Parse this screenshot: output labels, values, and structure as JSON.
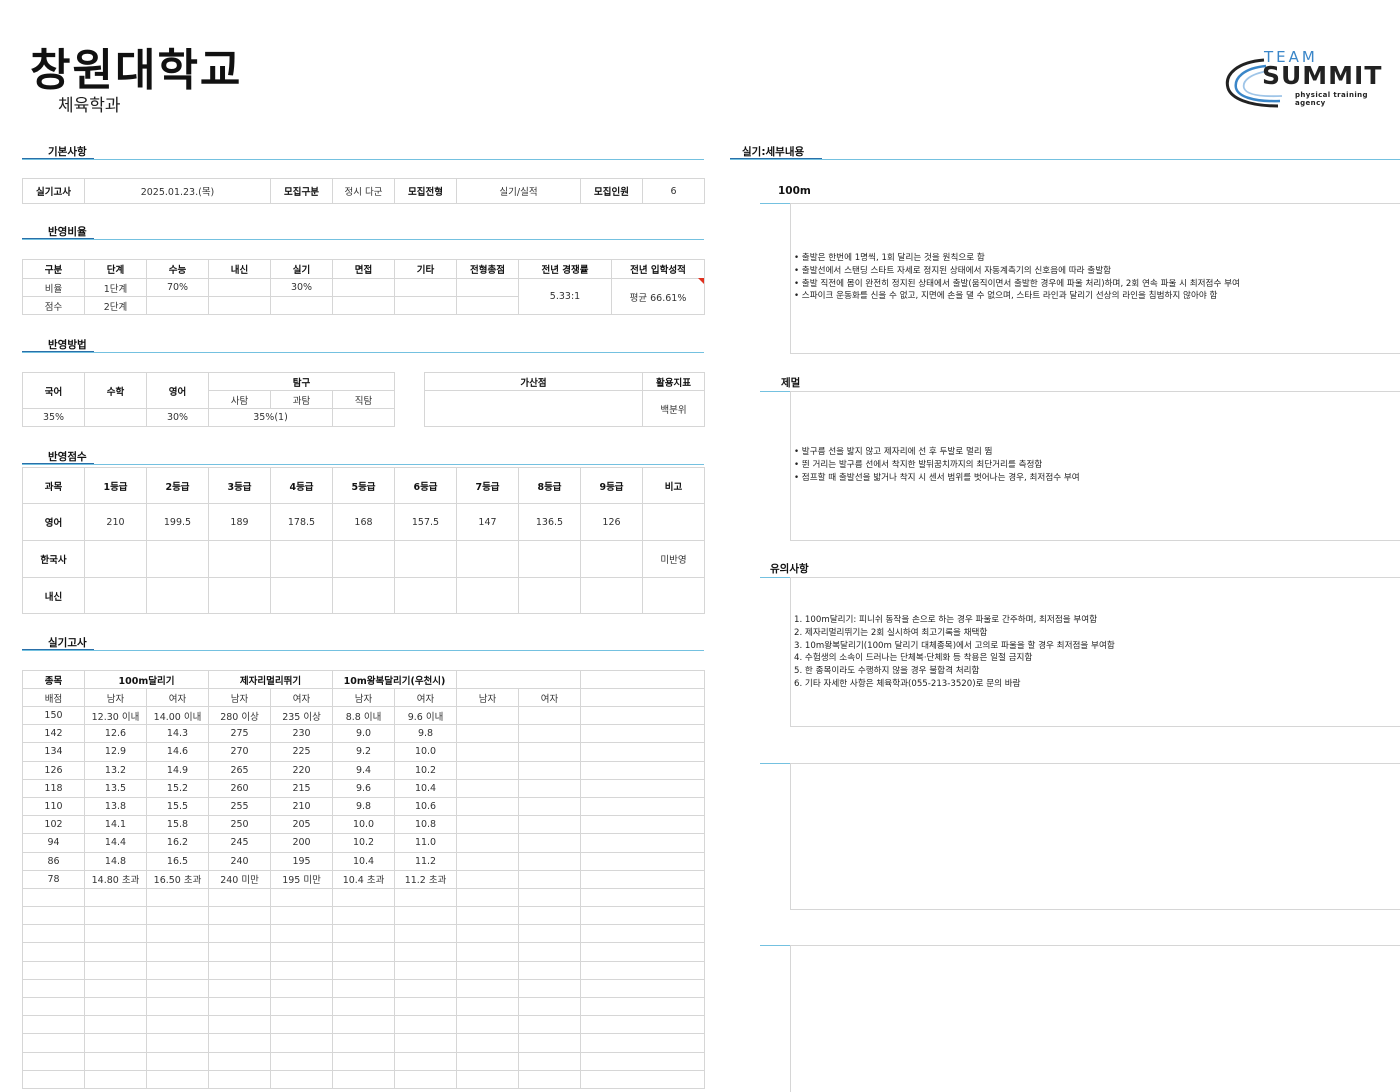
{
  "header": {
    "university": "창원대학교",
    "department": "체육학과"
  },
  "logo": {
    "team": "TEAM",
    "summit": "SUMMIT",
    "subtitle": "physical training agency",
    "accent": "#3a86c8"
  },
  "sections": {
    "basic": "기본사항",
    "ratio": "반영비율",
    "method": "반영방법",
    "score": "반영점수",
    "practical": "실기고사",
    "detail": "실기:세부내용"
  },
  "basic": {
    "exam_date_label": "실기고사",
    "exam_date": "2025.01.23.(목)",
    "recruit_type_label": "모집구분",
    "recruit_type": "정시 다군",
    "selection_label": "모집전형",
    "selection": "실기/실적",
    "quota_label": "모집인원",
    "quota": "6"
  },
  "ratio": {
    "headers": [
      "구분",
      "단계",
      "수능",
      "내신",
      "실기",
      "면접",
      "기타",
      "전형총점",
      "전년 경쟁률",
      "전년 입학성적"
    ],
    "row1": [
      "비율",
      "1단계",
      "70%",
      "",
      "30%",
      "",
      "",
      ""
    ],
    "row2": [
      "점수",
      "2단계",
      "",
      "",
      "",
      "",
      "",
      ""
    ],
    "competition": "5.33:1",
    "admission": "평균 66.61%"
  },
  "method": {
    "korean": "국어",
    "math": "수학",
    "english": "영어",
    "inquiry": "탐구",
    "social": "사탐",
    "science": "과탐",
    "vocational": "직탐",
    "bonus": "가산점",
    "indicator": "활용지표",
    "indicator_value": "백분위",
    "values": [
      "35%",
      "",
      "30%",
      "35%(1)",
      ""
    ]
  },
  "score": {
    "headers": [
      "과목",
      "1등급",
      "2등급",
      "3등급",
      "4등급",
      "5등급",
      "6등급",
      "7등급",
      "8등급",
      "9등급",
      "비고"
    ],
    "rows": [
      [
        "영어",
        "210",
        "199.5",
        "189",
        "178.5",
        "168",
        "157.5",
        "147",
        "136.5",
        "126",
        ""
      ],
      [
        "한국사",
        "",
        "",
        "",
        "",
        "",
        "",
        "",
        "",
        "",
        "미반영"
      ],
      [
        "내신",
        "",
        "",
        "",
        "",
        "",
        "",
        "",
        "",
        "",
        ""
      ]
    ]
  },
  "practical": {
    "item_label": "종목",
    "events": [
      "100m달리기",
      "제자리멀리뛰기",
      "10m왕복달리기(우천시)",
      ""
    ],
    "sub": [
      "배점",
      "남자",
      "여자",
      "남자",
      "여자",
      "남자",
      "여자",
      "남자",
      "여자",
      ""
    ],
    "rows": [
      [
        "150",
        "12.30 이내",
        "14.00 이내",
        "280 이상",
        "235 이상",
        "8.8 이내",
        "9.6 이내",
        "",
        "",
        ""
      ],
      [
        "142",
        "12.6",
        "14.3",
        "275",
        "230",
        "9.0",
        "9.8",
        "",
        "",
        ""
      ],
      [
        "134",
        "12.9",
        "14.6",
        "270",
        "225",
        "9.2",
        "10.0",
        "",
        "",
        ""
      ],
      [
        "126",
        "13.2",
        "14.9",
        "265",
        "220",
        "9.4",
        "10.2",
        "",
        "",
        ""
      ],
      [
        "118",
        "13.5",
        "15.2",
        "260",
        "215",
        "9.6",
        "10.4",
        "",
        "",
        ""
      ],
      [
        "110",
        "13.8",
        "15.5",
        "255",
        "210",
        "9.8",
        "10.6",
        "",
        "",
        ""
      ],
      [
        "102",
        "14.1",
        "15.8",
        "250",
        "205",
        "10.0",
        "10.8",
        "",
        "",
        ""
      ],
      [
        "94",
        "14.4",
        "16.2",
        "245",
        "200",
        "10.2",
        "11.0",
        "",
        "",
        ""
      ],
      [
        "86",
        "14.8",
        "16.5",
        "240",
        "195",
        "10.4",
        "11.2",
        "",
        "",
        ""
      ],
      [
        "78",
        "14.80 초과",
        "16.50 초과",
        "240 미만",
        "195 미만",
        "10.4 초과",
        "11.2 초과",
        "",
        "",
        ""
      ]
    ]
  },
  "detail": {
    "run_title": "100m",
    "run_items": [
      "• 출발은 한번에 1명씩, 1회 달리는 것을 원칙으로 함",
      "• 출발선에서 스탠딩 스타트 자세로 정지된 상태에서 자동계측기의 신호음에 따라 출발함",
      "• 출발 직전에 몸이 완전히 정지된 상태에서 출발(움직이면서 출발한 경우에 파울 처리)하며, 2회 연속 파울 시 최저점수 부여",
      "• 스파이크 운동화를 신을 수 없고, 지면에 손을 댈 수 없으며, 스타트 라인과 달리기 선상의 라인을 침범하지 않아야 함"
    ],
    "jump_title": "제멀",
    "jump_items": [
      "• 발구름 선을 밟지 않고 제자리에 선 후 두발로 멀리 뜀",
      "• 뛴 거리는 발구름 선에서 착지한 발뒤꿈치까지의 최단거리를 측정함",
      "• 점프할 때 출발선을 밟거나 착지 시 센서 범위를 벗어나는 경우, 최저점수 부여"
    ],
    "notice_title": "유의사항",
    "notice_items": [
      "1. 100m달리기: 피니쉬 동작을 손으로 하는 경우 파울로 간주하며, 최저점을 부여함",
      "2. 제자리멀리뛰기는 2회 실시하여 최고기록을 채택함",
      "3. 10m왕복달리기(100m 달리기 대체종목)에서 고의로 파울을 할 경우 최저점을 부여함",
      "4. 수험생의 소속이 드러나는 단체복·단체화 등 착용은 일절 금지함",
      "5. 한 종목이라도 수행하지 않을 경우 불합격 처리함",
      "6. 기타 자세한 사항은 체육학과(055-213-3520)로 문의 바람"
    ]
  }
}
